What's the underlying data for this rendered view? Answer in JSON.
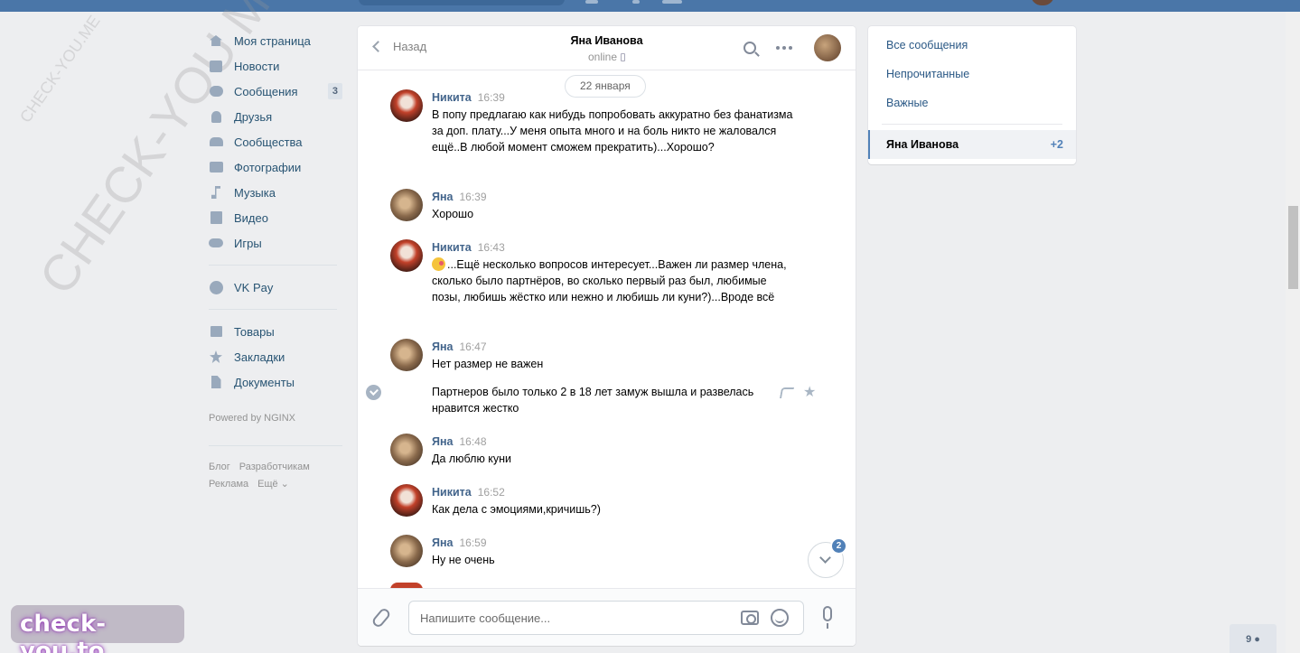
{
  "nav": {
    "items": [
      {
        "label": "Моя страница",
        "icon": "home-icon"
      },
      {
        "label": "Новости",
        "icon": "news-icon"
      },
      {
        "label": "Сообщения",
        "icon": "messages-icon",
        "badge": "3"
      },
      {
        "label": "Друзья",
        "icon": "friends-icon"
      },
      {
        "label": "Сообщества",
        "icon": "communities-icon"
      },
      {
        "label": "Фотографии",
        "icon": "photos-icon"
      },
      {
        "label": "Музыка",
        "icon": "music-icon"
      },
      {
        "label": "Видео",
        "icon": "video-icon"
      },
      {
        "label": "Игры",
        "icon": "games-icon"
      }
    ],
    "vkpay": "VK Pay",
    "extra": [
      "Товары",
      "Закладки",
      "Документы"
    ],
    "powered": "Powered by NGINX",
    "footer": [
      "Блог",
      "Разработчикам",
      "Реклама",
      "Ещё ⌄"
    ]
  },
  "chat": {
    "back_label": "Назад",
    "title": "Яна Иванова",
    "status": "online",
    "date": "22 января",
    "messages": [
      {
        "author": "Никита",
        "time": "16:39",
        "text": "В попу предлагаю как нибудь попробовать аккуратно без фанатизма за доп. плату...У меня опыта много и на боль никто не жаловался ещё..В любой момент сможем прекратить)...Хорошо?"
      },
      {
        "author": "Яна",
        "time": "16:39",
        "text": "Хорошо"
      },
      {
        "author": "Никита",
        "time": "16:43",
        "text": "...Ещё несколько вопросов интересует...Важен ли размер члена, сколько было партнёров, во сколько первый раз был, любимые позы, любишь жёстко или нежно и любишь ли куни?)...Вроде всё"
      },
      {
        "author": "Яна",
        "time": "16:47",
        "text": "Нет размер не важен"
      },
      {
        "author": "Яна",
        "time": "16:48",
        "text": "Да люблю куни"
      },
      {
        "author": "Никита",
        "time": "16:52",
        "text": "Как дела с эмоциями,кричишь?)"
      },
      {
        "author": "Яна",
        "time": "16:59",
        "text": "Ну не очень"
      }
    ],
    "followup": "Партнеров было только 2 в 18 лет замуж вышла и развелась нравится жестко",
    "unread_count": "2",
    "composer_placeholder": "Напишите сообщение..."
  },
  "right": {
    "filters": [
      "Все сообщения",
      "Непрочитанные",
      "Важные"
    ],
    "active_name": "Яна Иванова",
    "active_count": "+2"
  },
  "online_count": "9",
  "watermarks": {
    "small": "CHECK-YOU.ME",
    "large": "CHECK-YOU.ME",
    "brand": "check-you.to"
  },
  "colors": {
    "accent": "#4a76a8",
    "link": "#2a5885",
    "background": "#edeef0"
  }
}
